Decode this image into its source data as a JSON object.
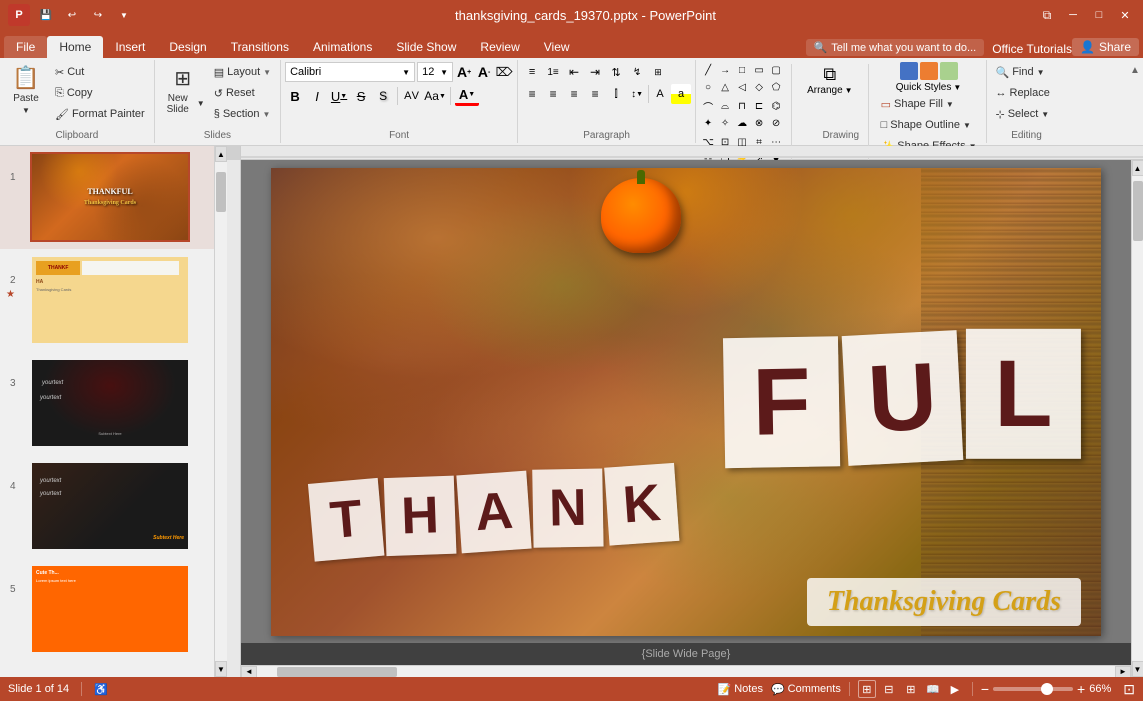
{
  "titlebar": {
    "filename": "thanksgiving_cards_19370.pptx - PowerPoint",
    "qat": [
      "save",
      "undo",
      "redo",
      "customize"
    ],
    "window_controls": [
      "restore",
      "minimize",
      "maximize",
      "close"
    ]
  },
  "ribbon": {
    "tabs": [
      "File",
      "Home",
      "Insert",
      "Design",
      "Transitions",
      "Animations",
      "Slide Show",
      "Review",
      "View"
    ],
    "active_tab": "Home",
    "search_placeholder": "Tell me what you want to do...",
    "office_tutorials": "Office Tutorials",
    "share_label": "Share",
    "groups": {
      "clipboard": {
        "label": "Clipboard",
        "paste_label": "Paste",
        "cut_label": "Cut",
        "copy_label": "Copy",
        "format_painter_label": "Format Painter"
      },
      "slides": {
        "label": "Slides",
        "new_slide_label": "New Slide",
        "layout_label": "Layout",
        "reset_label": "Reset",
        "section_label": "Section"
      },
      "font": {
        "label": "Font",
        "font_name": "Calibri",
        "font_size": "12",
        "bold": "B",
        "italic": "I",
        "underline": "U",
        "strikethrough": "S",
        "shadow": "S",
        "font_color": "A"
      },
      "paragraph": {
        "label": "Paragraph"
      },
      "drawing": {
        "label": "Drawing",
        "arrange_label": "Arrange",
        "quick_styles_label": "Quick Styles",
        "shape_fill_label": "Shape Fill",
        "shape_outline_label": "Shape Outline",
        "shape_effects_label": "Shape Effects"
      },
      "editing": {
        "label": "Editing",
        "find_label": "Find",
        "replace_label": "Replace",
        "select_label": "Select"
      }
    }
  },
  "slides_panel": {
    "slides": [
      {
        "num": "1",
        "star": false,
        "active": true
      },
      {
        "num": "2",
        "star": true
      },
      {
        "num": "3",
        "star": false
      },
      {
        "num": "4",
        "star": false
      },
      {
        "num": "5",
        "star": false
      }
    ]
  },
  "canvas": {
    "bottom_label": "{Slide Wide Page}"
  },
  "statusbar": {
    "slide_info": "Slide 1 of 14",
    "notes_label": "Notes",
    "comments_label": "Comments",
    "view_normal": "Normal",
    "view_outline": "Outline",
    "view_slide_sorter": "Slide Sorter",
    "view_reading": "Reading",
    "view_slideshow": "Slide Show",
    "zoom_level": "66%",
    "fit_label": "Fit"
  }
}
